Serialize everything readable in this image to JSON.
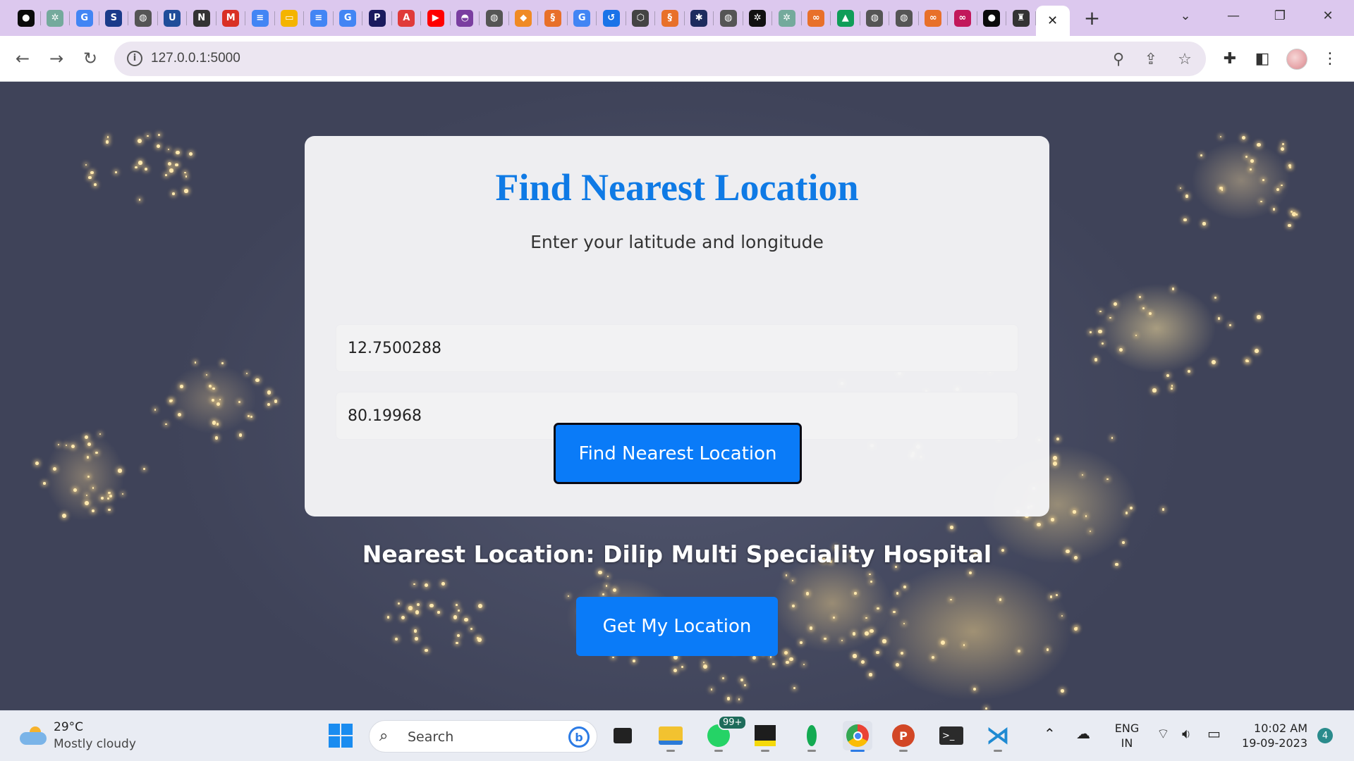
{
  "browser": {
    "tabs": [
      {
        "icon": "mongodb-icon",
        "color": "#0b0b0b",
        "glyph": "●"
      },
      {
        "icon": "chatgpt-icon",
        "color": "#74aa9c",
        "glyph": "✲"
      },
      {
        "icon": "google-icon",
        "color": "#4285f4",
        "glyph": "G"
      },
      {
        "icon": "sapling-icon",
        "color": "#1a3a8a",
        "glyph": "S"
      },
      {
        "icon": "globe-icon",
        "color": "#555555",
        "glyph": "◍"
      },
      {
        "icon": "uci-icon",
        "color": "#1f4d9a",
        "glyph": "U"
      },
      {
        "icon": "news-icon",
        "color": "#333333",
        "glyph": "N"
      },
      {
        "icon": "gmail-icon",
        "color": "#d93025",
        "glyph": "M"
      },
      {
        "icon": "docs-icon",
        "color": "#4285f4",
        "glyph": "≡"
      },
      {
        "icon": "slides-icon",
        "color": "#f4b400",
        "glyph": "▭"
      },
      {
        "icon": "docs-icon",
        "color": "#4285f4",
        "glyph": "≡"
      },
      {
        "icon": "google-icon",
        "color": "#4285f4",
        "glyph": "G"
      },
      {
        "icon": "pearson-icon",
        "color": "#1a1a5e",
        "glyph": "P"
      },
      {
        "icon": "acrobat-icon",
        "color": "#e03a3a",
        "glyph": "A"
      },
      {
        "icon": "youtube-icon",
        "color": "#ff0000",
        "glyph": "▶"
      },
      {
        "icon": "app-icon",
        "color": "#7a3ea0",
        "glyph": "◓"
      },
      {
        "icon": "globe-icon",
        "color": "#555555",
        "glyph": "◍"
      },
      {
        "icon": "diamond-icon",
        "color": "#f08a24",
        "glyph": "◆"
      },
      {
        "icon": "spiral-icon",
        "color": "#e8702a",
        "glyph": "§"
      },
      {
        "icon": "google-icon",
        "color": "#4285f4",
        "glyph": "G"
      },
      {
        "icon": "history-icon",
        "color": "#1a73e8",
        "glyph": "↺"
      },
      {
        "icon": "cube-icon",
        "color": "#444444",
        "glyph": "⬡"
      },
      {
        "icon": "spiral-icon",
        "color": "#e8702a",
        "glyph": "§"
      },
      {
        "icon": "asterisk-icon",
        "color": "#1d2b5e",
        "glyph": "✱"
      },
      {
        "icon": "globe-icon",
        "color": "#555555",
        "glyph": "◍"
      },
      {
        "icon": "openai-icon",
        "color": "#111111",
        "glyph": "✲"
      },
      {
        "icon": "chatgpt-icon",
        "color": "#74aa9c",
        "glyph": "✲"
      },
      {
        "icon": "infinity-icon",
        "color": "#e8702a",
        "glyph": "∞"
      },
      {
        "icon": "drive-icon",
        "color": "#0f9d58",
        "glyph": "▲"
      },
      {
        "icon": "globe-icon",
        "color": "#555555",
        "glyph": "◍"
      },
      {
        "icon": "globe-icon",
        "color": "#555555",
        "glyph": "◍"
      },
      {
        "icon": "infinity-icon",
        "color": "#e8702a",
        "glyph": "∞"
      },
      {
        "icon": "infinity-icon",
        "color": "#c2185b",
        "glyph": "∞"
      },
      {
        "icon": "mongodb-icon",
        "color": "#0b0b0b",
        "glyph": "●"
      },
      {
        "icon": "person-icon",
        "color": "#333333",
        "glyph": "♜"
      }
    ],
    "active_tab_close": "✕",
    "new_tab": "+",
    "url": "127.0.0.1:5000"
  },
  "page": {
    "title": "Find Nearest Location",
    "subtitle": "Enter your latitude and longitude",
    "latitude_value": "12.7500288",
    "longitude_value": "80.19968",
    "find_button": "Find Nearest Location",
    "result_text": "Nearest Location: Dilip Multi Speciality Hospital",
    "geo_button": "Get My Location"
  },
  "taskbar": {
    "temperature": "29°C",
    "weather": "Mostly cloudy",
    "search_placeholder": "Search",
    "whatsapp_badge": "99+",
    "lang_top": "ENG",
    "lang_bottom": "IN",
    "time": "10:02 AM",
    "date": "19-09-2023",
    "notifications": "4"
  },
  "colors": {
    "accent": "#0a7bf8",
    "title": "#0f7ae5",
    "tabstrip": "#dcc8ee"
  }
}
